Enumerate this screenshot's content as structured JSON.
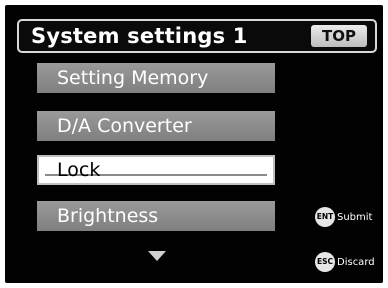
{
  "header": {
    "title": "System settings 1",
    "top_button": "TOP"
  },
  "menu": {
    "items": [
      {
        "label": "Setting Memory",
        "selected": false
      },
      {
        "label": "D/A Converter",
        "selected": false
      },
      {
        "label": "Lock",
        "selected": true
      },
      {
        "label": "Brightness",
        "selected": false
      }
    ],
    "more_below_icon": "triangle-down-icon"
  },
  "keys": {
    "enter": {
      "icon_text": "ENT",
      "label": "Submit"
    },
    "escape": {
      "icon_text": "ESC",
      "label": "Discard"
    }
  },
  "colors": {
    "background": "#020202",
    "item": "#8c8c8c",
    "selected_item": "#ffffff",
    "text": "#ffffff"
  }
}
